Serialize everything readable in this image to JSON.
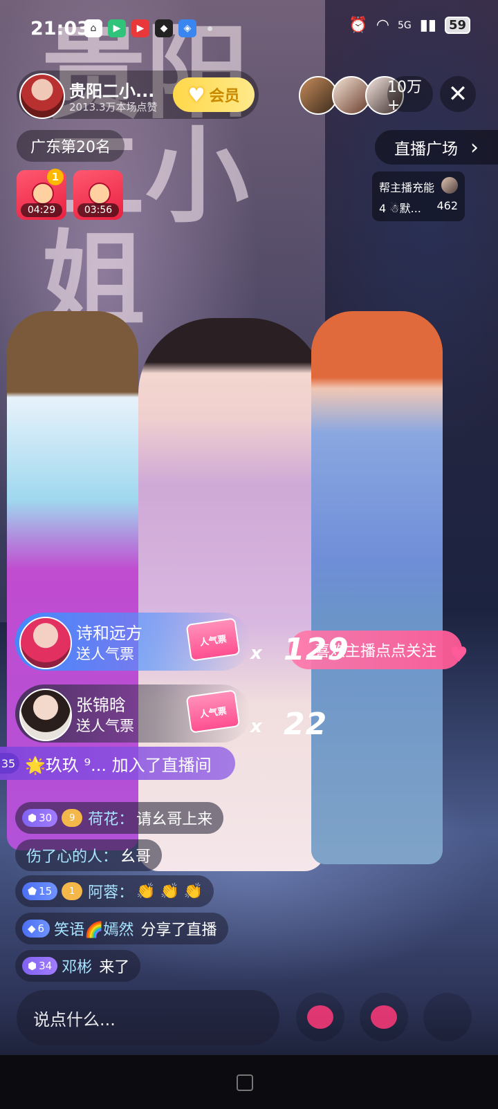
{
  "status": {
    "time": "21:03",
    "network": "5G",
    "battery": "59",
    "app_icons": [
      "home-app-icon",
      "video-app-icon",
      "red-app-icon",
      "dark-app-icon",
      "blue-app-icon"
    ]
  },
  "banner": {
    "chars": "贵阳\n二小\n姐"
  },
  "host": {
    "name": "贵阳二小...",
    "likes": "2013.3万本场点赞",
    "vip_label": "会员"
  },
  "viewers": {
    "count": "10万+"
  },
  "rank": {
    "label": "广东第20名"
  },
  "plaza": {
    "label": "直播广场",
    "chevron": "›"
  },
  "red_packets": [
    {
      "timer": "04:29",
      "badge": "1"
    },
    {
      "timer": "03:56"
    }
  ],
  "charge": {
    "title": "帮主播充能",
    "rank": "4 ☃默...",
    "value": "462"
  },
  "gifts": [
    {
      "user": "诗和远方",
      "action": "送人气票",
      "item": "人气票",
      "x": "x",
      "count": "129"
    },
    {
      "user": "张锦晗",
      "action": "送人气票",
      "item": "人气票",
      "x": "x",
      "count": "22"
    }
  ],
  "follow_prompt": "喜欢主播点点关注",
  "join": {
    "level": "35",
    "text": "🌟玖玖 ⁹... 加入了直播间"
  },
  "chat": [
    {
      "level": "30",
      "badge": "9",
      "user": "荷花：",
      "text": "请幺哥上来"
    },
    {
      "user": "伤了心的人：",
      "text": "幺哥"
    },
    {
      "level": "15",
      "badge": "1",
      "user": "阿蓉：",
      "text": "👏 👏 👏"
    },
    {
      "level": "6",
      "user": "笑语🌈嫣然",
      "text": "分享了直播"
    },
    {
      "level": "34",
      "user": "邓彬",
      "text": "来了"
    }
  ],
  "input": {
    "placeholder": "说点什么..."
  },
  "colors": {
    "accent_pink": "#ff5b9a",
    "vip_gold": "#ffd84a",
    "gift_blue": "#3c8cff",
    "join_purple": "#8246dc"
  }
}
